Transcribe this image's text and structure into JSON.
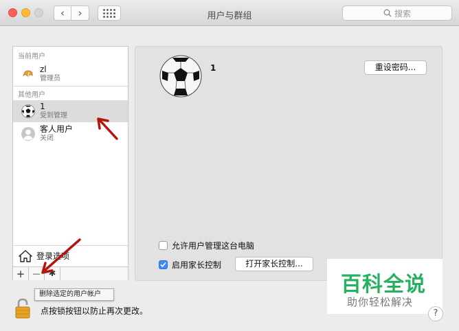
{
  "window": {
    "title": "用户与群组"
  },
  "toolbar": {
    "back_glyph": "‹",
    "forward_glyph": "›",
    "search_placeholder": "搜索"
  },
  "sidebar": {
    "current_label": "当前用户",
    "other_label": "其他用户",
    "current_user": {
      "name": "zl",
      "role": "管理员"
    },
    "other_users": [
      {
        "name": "1",
        "status": "受到管理"
      },
      {
        "name": "客人用户",
        "status": "关闭"
      }
    ],
    "login_options": "登录选项",
    "add_glyph": "+",
    "remove_glyph": "—",
    "gear_glyph": "✱"
  },
  "main": {
    "username": "1",
    "reset_password": "重设密码...",
    "allow_admin": {
      "label": "允许用户管理这台电脑",
      "checked": false
    },
    "parental": {
      "label": "启用家长控制",
      "checked": true
    },
    "open_parental": "打开家长控制..."
  },
  "tooltip": "删除选定的用户帐户",
  "lock_text": "点按锁按钮以防止再次更改。",
  "watermark": {
    "title": "百科全说",
    "subtitle": "助你轻松解决"
  },
  "help_glyph": "?",
  "colors": {
    "arrow": "#b3140f",
    "accent": "#3c8bf7",
    "watermark_green": "#25b15f"
  },
  "icons": [
    "search-icon",
    "house-icon",
    "lock-icon",
    "gear-icon",
    "soccer-ball-icon",
    "guest-icon",
    "fortune-cookie-icon"
  ]
}
